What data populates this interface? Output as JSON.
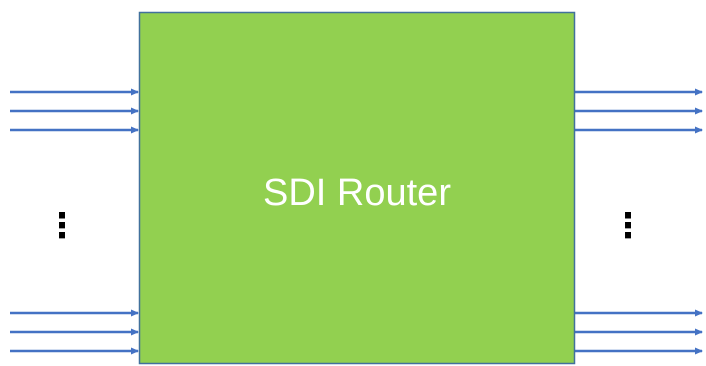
{
  "router": {
    "label": "SDI Router",
    "fill_color": "#92D050",
    "border_color": "#41719C"
  },
  "inputs": {
    "arrow_color": "#4472C4",
    "top_group_count": 3,
    "bottom_group_count": 3,
    "ellipsis": "⋮"
  },
  "outputs": {
    "arrow_color": "#4472C4",
    "top_group_count": 3,
    "bottom_group_count": 3,
    "ellipsis": "⋮"
  }
}
